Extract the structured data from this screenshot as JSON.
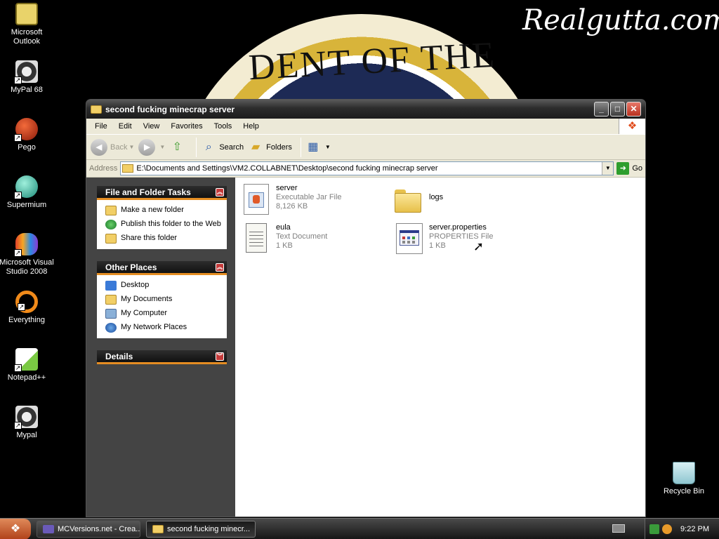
{
  "desktop": {
    "watermark": "Realgutta.com",
    "seal_text": "DENT OF THE",
    "icons": [
      {
        "label": "Microsoft Outlook"
      },
      {
        "label": "MyPal 68"
      },
      {
        "label": "Pego"
      },
      {
        "label": "Supermium"
      },
      {
        "label": "Microsoft Visual Studio 2008"
      },
      {
        "label": "Everything"
      },
      {
        "label": "Notepad++"
      },
      {
        "label": "Mypal"
      },
      {
        "label": "Recycle Bin"
      }
    ]
  },
  "window": {
    "title": "second fucking minecrap server",
    "menu": [
      "File",
      "Edit",
      "View",
      "Favorites",
      "Tools",
      "Help"
    ],
    "toolbar": {
      "back": "Back",
      "search": "Search",
      "folders": "Folders"
    },
    "address": {
      "label": "Address",
      "path": "E:\\Documents and Settings\\VM2.COLLABNET\\Desktop\\second fucking minecrap server",
      "go": "Go"
    },
    "tasks": {
      "file_folder_tasks": {
        "title": "File and Folder Tasks",
        "items": [
          "Make a new folder",
          "Publish this folder to the Web",
          "Share this folder"
        ]
      },
      "other_places": {
        "title": "Other Places",
        "items": [
          "Desktop",
          "My Documents",
          "My Computer",
          "My Network Places"
        ]
      },
      "details": {
        "title": "Details"
      }
    },
    "files": [
      {
        "name": "server",
        "type": "Executable Jar File",
        "size": "8,126 KB",
        "icon": "jar-file-icon"
      },
      {
        "name": "logs",
        "type": "",
        "size": "",
        "icon": "folder-icon"
      },
      {
        "name": "eula",
        "type": "Text Document",
        "size": "1 KB",
        "icon": "text-document-icon"
      },
      {
        "name": "server.properties",
        "type": "PROPERTIES File",
        "size": "1 KB",
        "icon": "properties-file-icon"
      }
    ]
  },
  "taskbar": {
    "items": [
      {
        "label": "MCVersions.net - Crea..."
      },
      {
        "label": "second fucking minecr..."
      }
    ],
    "clock": "9:22 PM"
  },
  "colors": {
    "accent_orange": "#e58d22",
    "window_chrome": "#2c2c2c",
    "taskpane_bg": "#444444"
  }
}
